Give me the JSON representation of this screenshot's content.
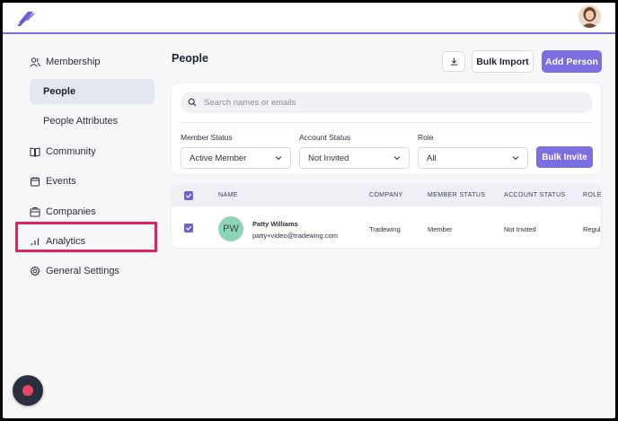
{
  "topbar": {
    "logo_icon": "tradewing-logo-icon",
    "avatar_icon": "user-avatar"
  },
  "sidebar": {
    "membership": {
      "label": "Membership",
      "icon": "users-icon"
    },
    "people": {
      "label": "People"
    },
    "people_attributes": {
      "label": "People Attributes"
    },
    "community": {
      "label": "Community",
      "icon": "book-icon"
    },
    "events": {
      "label": "Events",
      "icon": "calendar-icon"
    },
    "companies": {
      "label": "Companies",
      "icon": "building-icon"
    },
    "analytics": {
      "label": "Analytics",
      "icon": "bar-chart-icon"
    },
    "general_settings": {
      "label": "General Settings",
      "icon": "gear-icon"
    },
    "highlight_color": "#e3245c"
  },
  "main": {
    "title": "People",
    "download_icon": "download-icon",
    "bulk_import_label": "Bulk Import",
    "add_person_label": "Add Person",
    "accent_color": "#7b6ee0",
    "search": {
      "placeholder": "Search names or emails",
      "value": ""
    },
    "filters": {
      "member_status": {
        "label": "Member Status",
        "value": "Active Member"
      },
      "account_status": {
        "label": "Account Status",
        "value": "Not Invited"
      },
      "role": {
        "label": "Role",
        "value": "All"
      },
      "bulk_invite_label": "Bulk Invite"
    },
    "table": {
      "headers": {
        "name": "NAME",
        "company": "COMPANY",
        "member_status": "MEMBER STATUS",
        "account_status": "ACCOUNT STATUS",
        "role": "ROLE"
      },
      "rows": [
        {
          "initials": "PW",
          "name": "Patty Williams",
          "email": "patty+video@tradewing.com",
          "company": "Tradewing",
          "member_status": "Member",
          "account_status": "Not Invited",
          "role": "Regul",
          "checked": true
        }
      ]
    }
  },
  "recorder": {
    "icon": "record-icon"
  }
}
